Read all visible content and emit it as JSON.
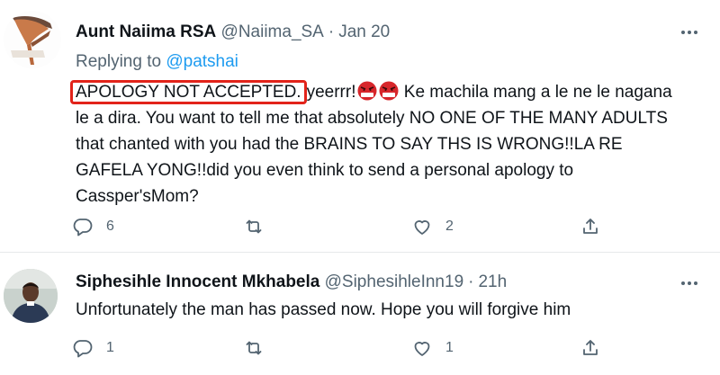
{
  "tweets": [
    {
      "author_name": "Aunt Naiima RSA",
      "handle": "@Naiima_SA",
      "separator": "·",
      "time": "Jan 20",
      "replying_prefix": "Replying to",
      "replying_to": "@patshai",
      "text_highlighted": "APOLOGY NOT ACCEPTED.",
      "text_after_highlight": "yeerrr!",
      "emojis": [
        "face-with-symbols-on-mouth",
        "face-with-symbols-on-mouth"
      ],
      "text_rest": " Ke machila mang a le ne le nagana le a dira. You want to tell me that absolutely NO ONE OF THE MANY ADULTS that chanted with you had the BRAINS TO SAY THS IS WRONG!!LA RE GAFELA YONG!!did you even think to send a personal apology to Cassper'sMom?",
      "reply_count": "6",
      "like_count": "2",
      "highlight_color": "#e2231a"
    },
    {
      "author_name": "Siphesihle Innocent Mkhabela",
      "handle": "@SiphesihleInn19",
      "separator": "·",
      "time": "21h",
      "text": "Unfortunately the man has passed now. Hope you will forgive him",
      "reply_count": "1",
      "like_count": "1"
    }
  ],
  "icons": [
    "avatar",
    "more-icon",
    "reply-icon",
    "retweet-icon",
    "like-icon",
    "share-icon"
  ],
  "colors": {
    "text": "#0f1419",
    "secondary": "#536471",
    "link": "#1d9bf0",
    "divider": "#e6e9eb"
  }
}
